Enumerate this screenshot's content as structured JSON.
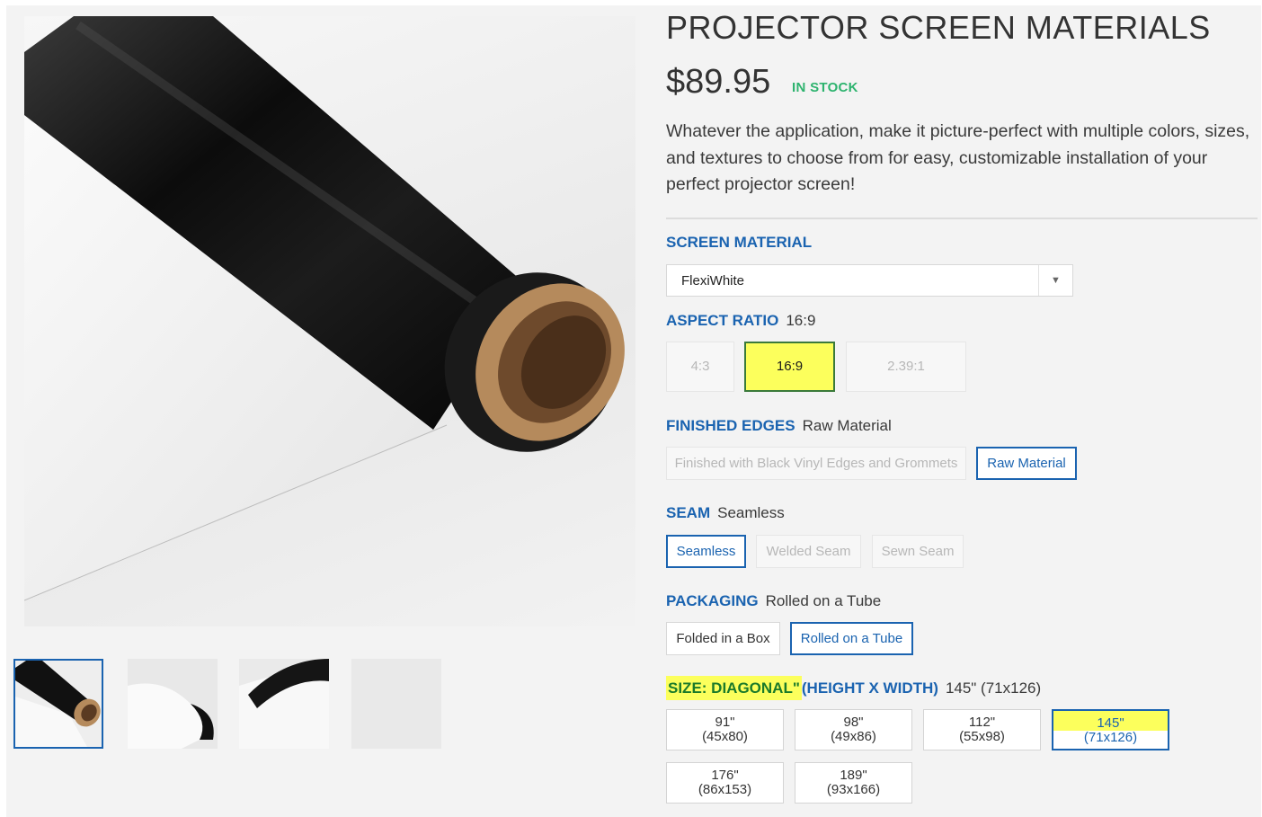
{
  "product": {
    "title": "PROJECTOR SCREEN MATERIALS",
    "price": "$89.95",
    "stock": "IN STOCK",
    "description": "Whatever the application, make it picture-perfect with multiple colors, sizes, and textures to choose from for easy, customizable installation of your perfect projector screen!"
  },
  "screen_material": {
    "label": "SCREEN MATERIAL",
    "selected": "FlexiWhite"
  },
  "aspect_ratio": {
    "label": "ASPECT RATIO",
    "value": "16:9",
    "options": [
      "4:3",
      "16:9",
      "2.39:1"
    ]
  },
  "finished_edges": {
    "label": "FINISHED EDGES",
    "value": "Raw Material",
    "options": [
      "Finished with Black Vinyl Edges and Grommets",
      "Raw Material"
    ]
  },
  "seam": {
    "label": "SEAM",
    "value": "Seamless",
    "options": [
      "Seamless",
      "Welded Seam",
      "Sewn Seam"
    ]
  },
  "packaging": {
    "label": "PACKAGING",
    "value": "Rolled on a Tube",
    "options": [
      "Folded in a Box",
      "Rolled on a Tube"
    ]
  },
  "size": {
    "label_highlight": "SIZE:  DIAGONAL\"",
    "label_rest": "(HEIGHT X WIDTH)",
    "value": "145\" (71x126)",
    "options": [
      {
        "diag": "91\"",
        "dims": "(45x80)"
      },
      {
        "diag": "98\"",
        "dims": "(49x86)"
      },
      {
        "diag": "112\"",
        "dims": "(55x98)"
      },
      {
        "diag": "145\"",
        "dims": "(71x126)"
      },
      {
        "diag": "176\"",
        "dims": "(86x153)"
      },
      {
        "diag": "189\"",
        "dims": "(93x166)"
      }
    ]
  },
  "colors": {
    "accent": "#1a63b0",
    "stock": "#2db36e",
    "highlight": "#fcff5c"
  }
}
